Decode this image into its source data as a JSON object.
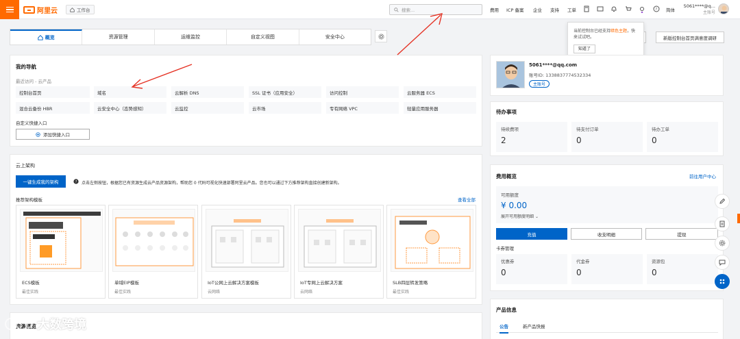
{
  "topbar": {
    "logo_text": "阿里云",
    "workbench": "工作台",
    "search_placeholder": "搜索...",
    "nav": [
      "费用",
      "ICP 备案",
      "企业",
      "支持",
      "工单"
    ],
    "lang": "简体",
    "account_name": "5061****@q...",
    "account_role": "主账号"
  },
  "tabs": [
    "概览",
    "资源管理",
    "运维监控",
    "自定义视图",
    "安全中心"
  ],
  "tip": {
    "text_pre": "当前控制台已经支持",
    "text_hl": "暗色主题",
    "text_post": "，快来试试吧。",
    "button": "知道了"
  },
  "header_buttons": [
    "新版控制台首页满意度调研"
  ],
  "nav_card": {
    "title": "我的导航",
    "recent_label": "最近访问 - 云产品",
    "recent": [
      [
        "控制台首页",
        "域名",
        "云解析 DNS",
        "SSL 证书（应用安全）",
        "访问控制",
        "云服务器 ECS"
      ],
      [
        "混合云备份 HBR",
        "云安全中心（态势感知）",
        "云监控",
        "云市场",
        "专有网络 VPC",
        "轻量应用服务器"
      ]
    ],
    "custom_label": "自定义快捷入口",
    "add_button": "添加快捷入口"
  },
  "arch_card": {
    "title": "云上架构",
    "gen_button": "一键生成我的架构",
    "desc": "点击左侧按钮，根据您已有资源生成云产品资源架构，帮助您 0 代码可视化快速部署阿里云产品。您也可以通过下方推荐架构直接创建新架构。",
    "recommend_label": "推荐架构模板",
    "view_all": "查看全部",
    "templates": [
      {
        "title": "ECS模板",
        "sub": "最佳实践"
      },
      {
        "title": "单域EIP模板",
        "sub": "最佳实践"
      },
      {
        "title": "IoT公网上云解决方案模板",
        "sub": "云网络"
      },
      {
        "title": "IoT专网上云解决方案",
        "sub": "云网络"
      },
      {
        "title": "SLB四层转发策略",
        "sub": "最佳实践"
      }
    ]
  },
  "resource_title": "资源概览",
  "profile": {
    "email": "5061****@qq.com",
    "account_id": "账号ID: 1338837774532334",
    "badge": "主账号"
  },
  "todo": {
    "title": "待办事项",
    "items": [
      {
        "label": "待续费项",
        "value": "2"
      },
      {
        "label": "待支付订单",
        "value": "0"
      },
      {
        "label": "待办工单",
        "value": "0"
      }
    ]
  },
  "fee": {
    "title": "费用概览",
    "link": "前往用户中心",
    "balance_label": "可用额度",
    "balance": "¥ 0.00",
    "detail": "展开可用额度明细",
    "buttons": [
      "充值",
      "收支明细",
      "提现"
    ],
    "coupon_label": "卡券管理",
    "coupons": [
      {
        "label": "优惠券",
        "value": "0"
      },
      {
        "label": "代金券",
        "value": "0"
      },
      {
        "label": "资源包",
        "value": "0"
      }
    ]
  },
  "product": {
    "title": "产品信息",
    "tabs": [
      "公告",
      "新产品快报"
    ]
  },
  "watermark": "大数跨境"
}
